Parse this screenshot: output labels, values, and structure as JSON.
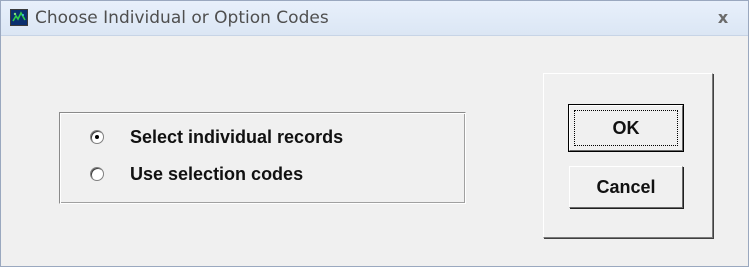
{
  "window": {
    "title": "Choose Individual or Option Codes",
    "app_icon": "app-logo-icon",
    "close_label": "x"
  },
  "options": {
    "selected_index": 0,
    "items": [
      {
        "label": "Select individual records",
        "checked": true
      },
      {
        "label": "Use selection codes",
        "checked": false
      }
    ]
  },
  "buttons": {
    "ok_label": "OK",
    "cancel_label": "Cancel"
  }
}
